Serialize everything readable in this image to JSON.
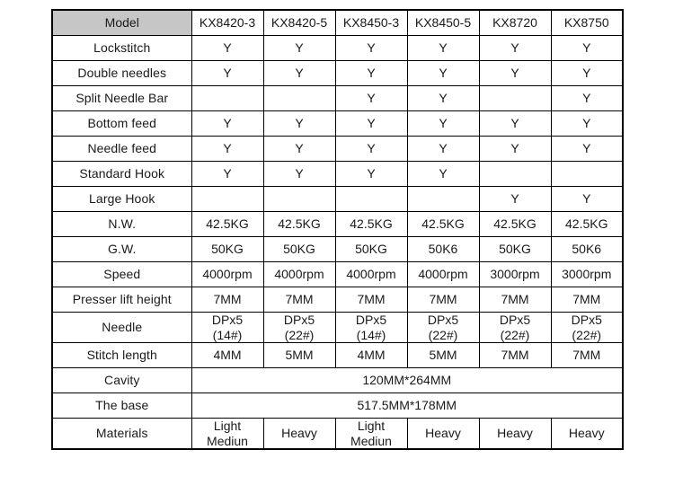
{
  "table": {
    "title_cell": "Model",
    "columns": [
      "KX8420-3",
      "KX8420-5",
      "KX8450-3",
      "KX8450-5",
      "KX8720",
      "KX8750"
    ],
    "colors": {
      "label_background": "#1f5082",
      "label_text": "#ffffff",
      "header_background": "#c6c6c6",
      "header_text": "#2f4e6e",
      "cell_background": "#ffffff",
      "cell_text": "#1a1a1a",
      "border": "#000000"
    },
    "rows": [
      {
        "label": "Lockstitch",
        "values": [
          "Y",
          "Y",
          "Y",
          "Y",
          "Y",
          "Y"
        ]
      },
      {
        "label": "Double needles",
        "values": [
          "Y",
          "Y",
          "Y",
          "Y",
          "Y",
          "Y"
        ]
      },
      {
        "label": "Split Needle Bar",
        "values": [
          "",
          "",
          "Y",
          "Y",
          "",
          "Y"
        ]
      },
      {
        "label": "Bottom feed",
        "values": [
          "Y",
          "Y",
          "Y",
          "Y",
          "Y",
          "Y"
        ]
      },
      {
        "label": "Needle feed",
        "values": [
          "Y",
          "Y",
          "Y",
          "Y",
          "Y",
          "Y"
        ]
      },
      {
        "label": "Standard Hook",
        "values": [
          "Y",
          "Y",
          "Y",
          "Y",
          "",
          ""
        ]
      },
      {
        "label": "Large Hook",
        "values": [
          "",
          "",
          "",
          "",
          "Y",
          "Y"
        ]
      },
      {
        "label": "N.W.",
        "values": [
          "42.5KG",
          "42.5KG",
          "42.5KG",
          "42.5KG",
          "42.5KG",
          "42.5KG"
        ]
      },
      {
        "label": "G.W.",
        "values": [
          "50KG",
          "50KG",
          "50KG",
          "50K6",
          "50KG",
          "50K6"
        ]
      },
      {
        "label": "Speed",
        "values": [
          "4000rpm",
          "4000rpm",
          "4000rpm",
          "4000rpm",
          "3000rpm",
          "3000rpm"
        ]
      },
      {
        "label": "Presser lift height",
        "values": [
          "7MM",
          "7MM",
          "7MM",
          "7MM",
          "7MM",
          "7MM"
        ]
      },
      {
        "label": "Needle",
        "values_line1": [
          "DPx5",
          "DPx5",
          "DPx5",
          "DPx5",
          "DPx5",
          "DPx5"
        ],
        "values_line2": [
          "(14#)",
          "(22#)",
          "(14#)",
          "(22#)",
          "(22#)",
          "(22#)"
        ]
      },
      {
        "label": "Stitch length",
        "values": [
          "4MM",
          "5MM",
          "4MM",
          "5MM",
          "7MM",
          "7MM"
        ]
      },
      {
        "label": "Cavity",
        "span_value": "120MM*264MM"
      },
      {
        "label": "The base",
        "span_value": "517.5MM*178MM"
      },
      {
        "label": "Materials",
        "values_line1": [
          "Light",
          "Heavy",
          "Light",
          "Heavy",
          "Heavy",
          "Heavy"
        ],
        "values_line2": [
          "Mediun",
          "",
          "Mediun",
          "",
          "",
          ""
        ]
      }
    ]
  }
}
